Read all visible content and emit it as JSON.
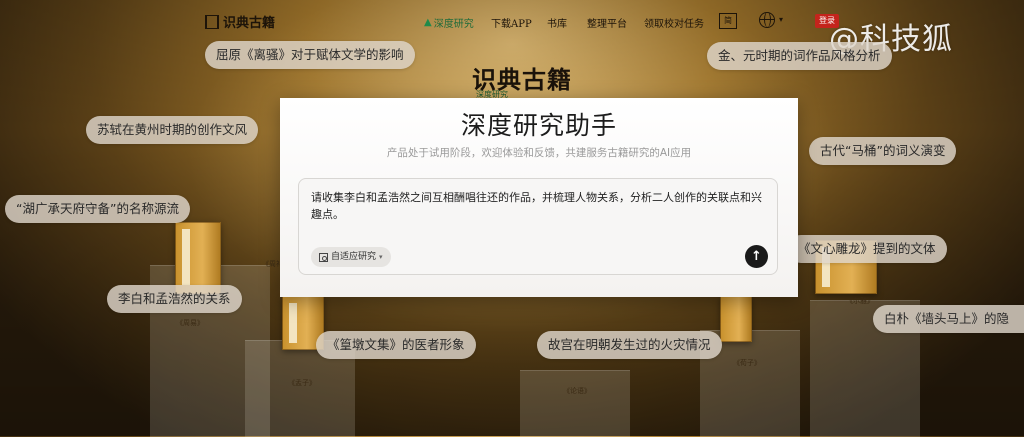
{
  "nav": {
    "logo": "识典古籍",
    "items": [
      {
        "label": "深度研究",
        "active": true
      },
      {
        "label": "下载APP"
      },
      {
        "label": "书库"
      },
      {
        "label": "整理平台"
      },
      {
        "label": "领取校对任务"
      }
    ],
    "box_icon_label": "简",
    "login_label": "登录"
  },
  "watermark": "@科技狐",
  "hero": {
    "title": "识典古籍",
    "subtitle": "深度研究"
  },
  "chips": [
    "屈原《离骚》对于赋体文学的影响",
    "金、元时期的词作品风格分析",
    "苏轼在黄州时期的创作文风",
    "古代“马桶”的词义演变",
    "“湖广承天府守备”的名称源流",
    "《文心雕龙》提到的文体",
    "李白和孟浩然的关系",
    "白朴《墙头马上》的隐",
    "《篁墩文集》的医者形象",
    "故宫在明朝发生过的火灾情况"
  ],
  "modal": {
    "title": "深度研究助手",
    "subtitle": "产品处于试用阶段，欢迎体验和反馈，共建服务古籍研究的AI应用",
    "input_value": "请收集李白和孟浩然之间互相酬唱往还的作品，并梳理人物关系，分析二人创作的关联点和兴趣点。",
    "mode_label": "自适应研究",
    "send_icon": "arrow-up-icon"
  },
  "book_captions": [
    "《周礼》",
    "《周易》",
    "《孟子》",
    "《荀子》",
    "《尔雅》",
    "《论语》"
  ],
  "colors": {
    "accent_green": "#1f6b3a",
    "login_red": "#c4241c",
    "send_dark": "#1a1a1a"
  }
}
